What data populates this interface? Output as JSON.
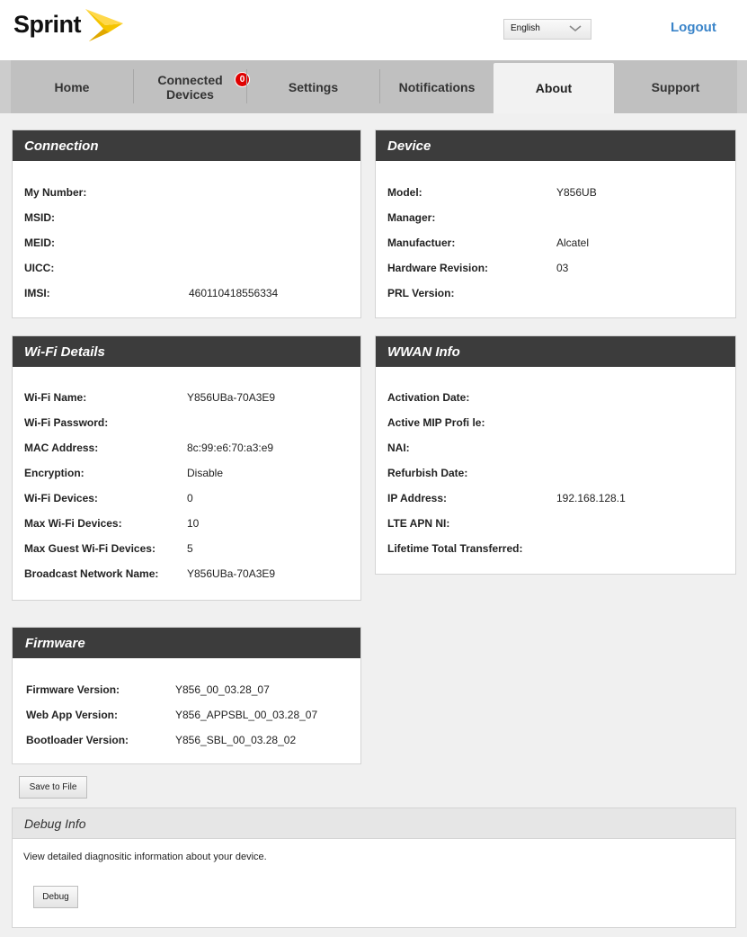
{
  "brand": {
    "logo_text": "Sprint"
  },
  "header": {
    "language": "English",
    "logout": "Logout"
  },
  "nav": {
    "tabs": [
      {
        "label": "Home"
      },
      {
        "label": "Connected Devices",
        "badge": "0"
      },
      {
        "label": "Settings"
      },
      {
        "label": "Notifications"
      },
      {
        "label": "About",
        "active": true
      },
      {
        "label": "Support"
      }
    ]
  },
  "connection": {
    "title": "Connection",
    "rows": [
      {
        "label": "My Number:",
        "value": ""
      },
      {
        "label": "MSID:",
        "value": ""
      },
      {
        "label": "MEID:",
        "value": ""
      },
      {
        "label": "UICC:",
        "value": ""
      },
      {
        "label": "IMSI:",
        "value": "460110418556334"
      }
    ]
  },
  "device": {
    "title": "Device",
    "rows": [
      {
        "label": "Model:",
        "value": "Y856UB"
      },
      {
        "label": "Manager:",
        "value": ""
      },
      {
        "label": "Manufactuer:",
        "value": "Alcatel"
      },
      {
        "label": "Hardware Revision:",
        "value": "03"
      },
      {
        "label": "PRL Version:",
        "value": ""
      }
    ]
  },
  "wifi": {
    "title": "Wi-Fi Details",
    "rows": [
      {
        "label": "Wi-Fi Name:",
        "value": "Y856UBa-70A3E9"
      },
      {
        "label": "Wi-Fi Password:",
        "value": ""
      },
      {
        "label": "MAC Address:",
        "value": "8c:99:e6:70:a3:e9"
      },
      {
        "label": "Encryption:",
        "value": "Disable"
      },
      {
        "label": "Wi-Fi Devices:",
        "value": "0"
      },
      {
        "label": "Max Wi-Fi Devices:",
        "value": "10"
      },
      {
        "label": "Max Guest Wi-Fi Devices:",
        "value": "5"
      },
      {
        "label": "Broadcast Network Name:",
        "value": "Y856UBa-70A3E9"
      }
    ]
  },
  "wwan": {
    "title": "WWAN Info",
    "rows": [
      {
        "label": "Activation Date:",
        "value": ""
      },
      {
        "label": "Active MIP Profi le:",
        "value": ""
      },
      {
        "label": "NAI:",
        "value": ""
      },
      {
        "label": "Refurbish Date:",
        "value": ""
      },
      {
        "label": "IP Address:",
        "value": "192.168.128.1"
      },
      {
        "label": "LTE APN NI:",
        "value": ""
      },
      {
        "label": "Lifetime Total Transferred:",
        "value": ""
      }
    ]
  },
  "firmware": {
    "title": "Firmware",
    "rows": [
      {
        "label": "Firmware Version:",
        "value": "Y856_00_03.28_07"
      },
      {
        "label": "Web App Version:",
        "value": "Y856_APPSBL_00_03.28_07"
      },
      {
        "label": "Bootloader Version:",
        "value": "Y856_SBL_00_03.28_02"
      }
    ]
  },
  "actions": {
    "save_to_file": "Save to File"
  },
  "debug": {
    "title": "Debug Info",
    "description": "View detailed diagnositic information about your device.",
    "button": "Debug"
  },
  "colors": {
    "nav_bg": "#c0c0c0",
    "panel_head": "#3c3c3c",
    "link": "#3a84c9",
    "badge": "#e00000",
    "logo_yellow": "#f5c400"
  }
}
